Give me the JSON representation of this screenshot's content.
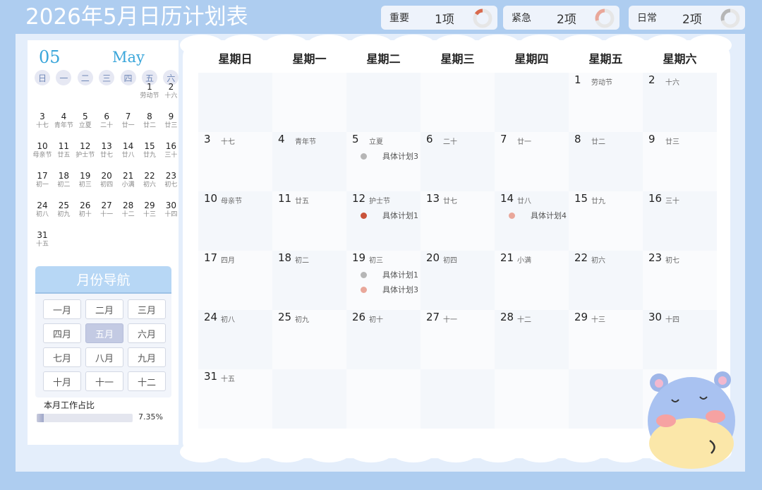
{
  "header": {
    "title": "2026年5月日历计划表"
  },
  "summary": [
    {
      "label": "重要",
      "count": "1项",
      "color": "#d96a4d"
    },
    {
      "label": "紧急",
      "count": "2项",
      "color": "#e9a79a"
    },
    {
      "label": "日常",
      "count": "2项",
      "color": "#b6b6b6"
    }
  ],
  "mini_calendar": {
    "day": "05",
    "month": "May",
    "weekdays": [
      "日",
      "一",
      "二",
      "三",
      "四",
      "五",
      "六"
    ],
    "days": [
      {
        "n": "1",
        "s": "劳动节"
      },
      {
        "n": "2",
        "s": "十六"
      },
      {
        "n": "3",
        "s": "十七"
      },
      {
        "n": "4",
        "s": "青年节"
      },
      {
        "n": "5",
        "s": "立夏"
      },
      {
        "n": "6",
        "s": "二十"
      },
      {
        "n": "7",
        "s": "廿一"
      },
      {
        "n": "8",
        "s": "廿二"
      },
      {
        "n": "9",
        "s": "廿三"
      },
      {
        "n": "10",
        "s": "母亲节"
      },
      {
        "n": "11",
        "s": "廿五"
      },
      {
        "n": "12",
        "s": "护士节"
      },
      {
        "n": "13",
        "s": "廿七"
      },
      {
        "n": "14",
        "s": "廿八"
      },
      {
        "n": "15",
        "s": "廿九"
      },
      {
        "n": "16",
        "s": "三十"
      },
      {
        "n": "17",
        "s": "初一"
      },
      {
        "n": "18",
        "s": "初二"
      },
      {
        "n": "19",
        "s": "初三"
      },
      {
        "n": "20",
        "s": "初四"
      },
      {
        "n": "21",
        "s": "小满"
      },
      {
        "n": "22",
        "s": "初六"
      },
      {
        "n": "23",
        "s": "初七"
      },
      {
        "n": "24",
        "s": "初八"
      },
      {
        "n": "25",
        "s": "初九"
      },
      {
        "n": "26",
        "s": "初十"
      },
      {
        "n": "27",
        "s": "十一"
      },
      {
        "n": "28",
        "s": "十二"
      },
      {
        "n": "29",
        "s": "十三"
      },
      {
        "n": "30",
        "s": "十四"
      },
      {
        "n": "31",
        "s": "十五"
      }
    ]
  },
  "month_nav": {
    "title": "月份导航",
    "months": [
      "一月",
      "二月",
      "三月",
      "四月",
      "五月",
      "六月",
      "七月",
      "八月",
      "九月",
      "十月",
      "十一",
      "十二"
    ],
    "active_index": 4
  },
  "work_ratio": {
    "label": "本月工作占比",
    "percent_text": "7.35%",
    "value": 0.0735
  },
  "calendar": {
    "weekdays": [
      "星期日",
      "星期一",
      "星期二",
      "星期三",
      "星期四",
      "星期五",
      "星期六"
    ],
    "days": [
      {
        "n": "1",
        "lunar": "劳动节",
        "plans": []
      },
      {
        "n": "2",
        "lunar": "十六",
        "plans": []
      },
      {
        "n": "3",
        "lunar": "十七",
        "plans": []
      },
      {
        "n": "4",
        "lunar": "青年节",
        "plans": []
      },
      {
        "n": "5",
        "lunar": "立夏",
        "plans": [
          {
            "text": "具体计划3",
            "color": "#b6b6b6"
          }
        ]
      },
      {
        "n": "6",
        "lunar": "二十",
        "plans": []
      },
      {
        "n": "7",
        "lunar": "廿一",
        "plans": []
      },
      {
        "n": "8",
        "lunar": "廿二",
        "plans": []
      },
      {
        "n": "9",
        "lunar": "廿三",
        "plans": []
      },
      {
        "n": "10",
        "lunar": "母亲节",
        "plans": []
      },
      {
        "n": "11",
        "lunar": "廿五",
        "plans": []
      },
      {
        "n": "12",
        "lunar": "护士节",
        "plans": [
          {
            "text": "具体计划1",
            "color": "#c9533a"
          }
        ]
      },
      {
        "n": "13",
        "lunar": "廿七",
        "plans": []
      },
      {
        "n": "14",
        "lunar": "廿八",
        "plans": [
          {
            "text": "具体计划4",
            "color": "#e9a79a"
          }
        ]
      },
      {
        "n": "15",
        "lunar": "廿九",
        "plans": []
      },
      {
        "n": "16",
        "lunar": "三十",
        "plans": []
      },
      {
        "n": "17",
        "lunar": "四月",
        "plans": []
      },
      {
        "n": "18",
        "lunar": "初二",
        "plans": []
      },
      {
        "n": "19",
        "lunar": "初三",
        "plans": [
          {
            "text": "具体计划1",
            "color": "#b6b6b6"
          },
          {
            "text": "具体计划3",
            "color": "#e9a79a"
          }
        ]
      },
      {
        "n": "20",
        "lunar": "初四",
        "plans": []
      },
      {
        "n": "21",
        "lunar": "小满",
        "plans": []
      },
      {
        "n": "22",
        "lunar": "初六",
        "plans": []
      },
      {
        "n": "23",
        "lunar": "初七",
        "plans": []
      },
      {
        "n": "24",
        "lunar": "初八",
        "plans": []
      },
      {
        "n": "25",
        "lunar": "初九",
        "plans": []
      },
      {
        "n": "26",
        "lunar": "初十",
        "plans": []
      },
      {
        "n": "27",
        "lunar": "十一",
        "plans": []
      },
      {
        "n": "28",
        "lunar": "十二",
        "plans": []
      },
      {
        "n": "29",
        "lunar": "十三",
        "plans": []
      },
      {
        "n": "30",
        "lunar": "十四",
        "plans": []
      },
      {
        "n": "31",
        "lunar": "十五",
        "plans": []
      }
    ],
    "first_weekday": 5
  },
  "colors": {
    "accent": "#3aa6da",
    "cell_a": "#f4f7fb",
    "cell_b": "#fafbfd"
  }
}
